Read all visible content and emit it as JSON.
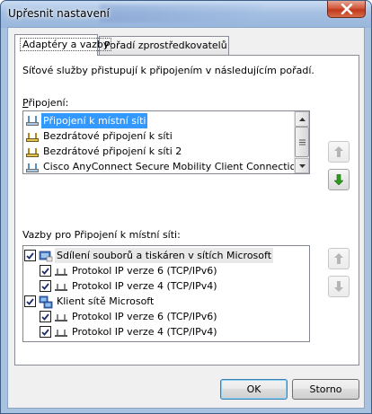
{
  "window": {
    "title": "Upřesnit nastavení",
    "colors": {
      "frame": "#a9c2df",
      "close": "#c0381c",
      "selection": "#3399ff"
    }
  },
  "tabs": [
    {
      "label": "Adaptéry a vazby",
      "active": true
    },
    {
      "label": "Pořadí zprostředkovatelů",
      "active": false
    }
  ],
  "panel": {
    "description": "Síťové služby přistupují k připojením v následujícím pořadí.",
    "connections_label": "Připojení:",
    "connections": [
      {
        "label": "Připojení k místní síti",
        "icon": "wired-network-icon",
        "selected": true
      },
      {
        "label": "Bezdrátové připojení k síti",
        "icon": "wireless-network-icon",
        "selected": false
      },
      {
        "label": "Bezdrátové připojení k síti 2",
        "icon": "wireless-network-icon",
        "selected": false
      },
      {
        "label": "Cisco AnyConnect Secure Mobility Client Connection",
        "icon": "wired-network-icon",
        "selected": false
      }
    ],
    "bindings_label": "Vazby pro Připojení k místní síti:",
    "bindings": [
      {
        "label": "Sdílení souborů a tiskáren v sítích Microsoft",
        "level": 0,
        "checked": true,
        "icon": "file-printer-sharing-icon",
        "highlighted": true
      },
      {
        "label": "Protokol IP verze 6 (TCP/IPv6)",
        "level": 1,
        "checked": true
      },
      {
        "label": "Protokol IP verze 4 (TCP/IPv4)",
        "level": 1,
        "checked": true
      },
      {
        "label": "Klient sítě Microsoft",
        "level": 0,
        "checked": true,
        "icon": "network-client-icon",
        "highlighted": false
      },
      {
        "label": "Protokol IP verze 6 (TCP/IPv6)",
        "level": 1,
        "checked": true
      },
      {
        "label": "Protokol IP verze 4 (TCP/IPv4)",
        "level": 1,
        "checked": true
      }
    ]
  },
  "buttons": {
    "ok": "OK",
    "cancel": "Storno"
  }
}
